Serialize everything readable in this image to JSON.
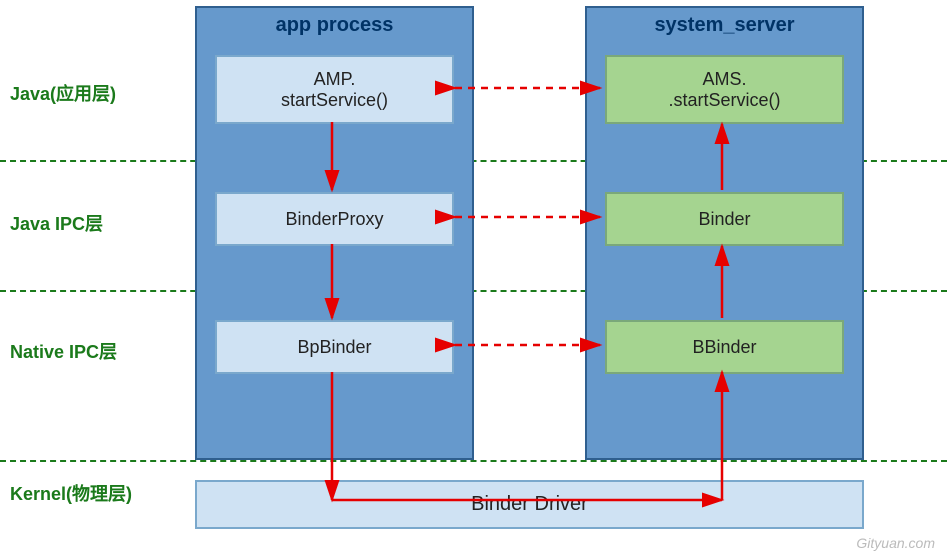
{
  "layers": {
    "java_app": "Java(应用层)",
    "java_ipc": "Java IPC层",
    "native_ipc": "Native IPC层",
    "kernel": "Kernel(物理层)"
  },
  "columns": {
    "left_title": "app process",
    "right_title": "system_server"
  },
  "boxes": {
    "left_top_line1": "AMP.",
    "left_top_line2": "startService()",
    "left_mid": "BinderProxy",
    "left_bot": "BpBinder",
    "right_top_line1": "AMS.",
    "right_top_line2": ".startService()",
    "right_mid": "Binder",
    "right_bot": "BBinder"
  },
  "driver": "Binder Driver",
  "watermark": "Gityuan.com",
  "colors": {
    "container_fill": "#6699cc",
    "box_blue": "#cfe2f3",
    "box_green": "#a5d490",
    "divider": "#1b7a1b",
    "solid_arrow": "#e60000",
    "dashed_arrow": "#e60000"
  }
}
